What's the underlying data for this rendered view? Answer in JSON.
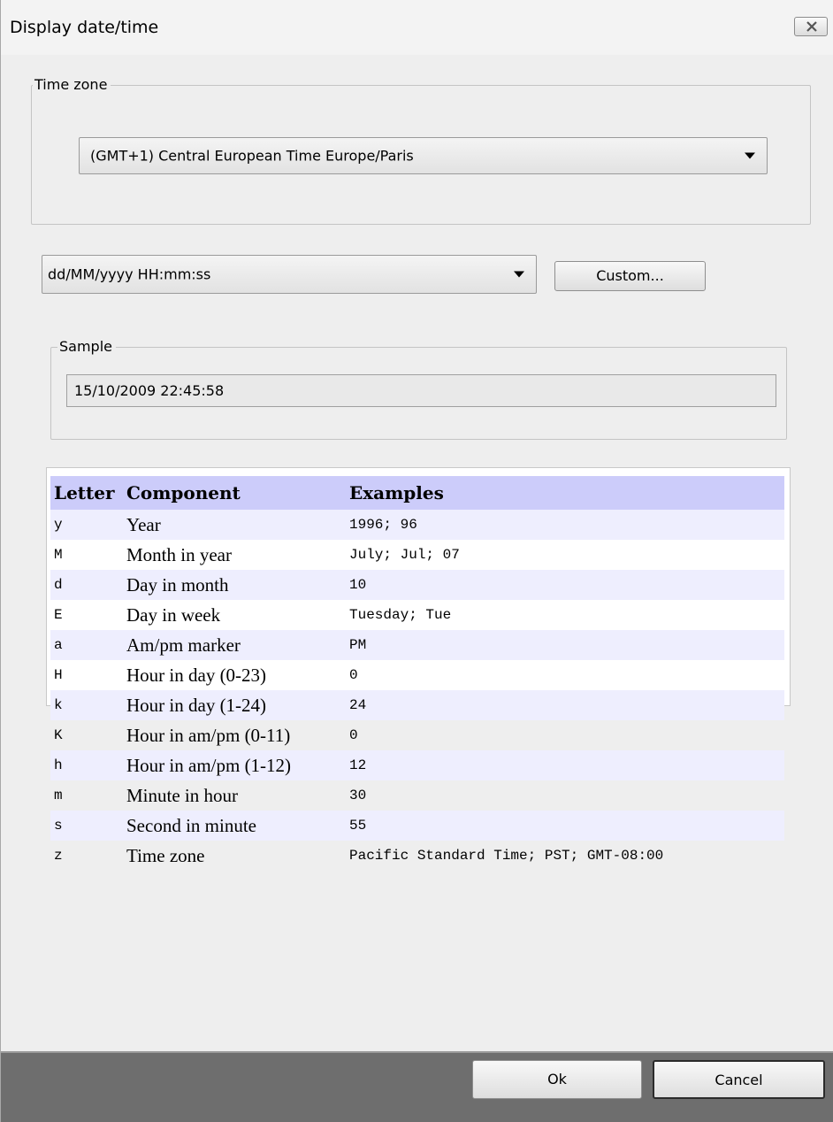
{
  "window": {
    "title": "Display date/time",
    "close_icon": "close-icon"
  },
  "timezone_group": {
    "legend": "Time zone",
    "selected": "(GMT+1) Central European Time Europe/Paris"
  },
  "format": {
    "selected": "dd/MM/yyyy HH:mm:ss",
    "custom_button": "Custom..."
  },
  "sample_group": {
    "legend": "Sample",
    "value": "15/10/2009 22:45:58"
  },
  "help_table": {
    "headers": [
      "Letter",
      "Component",
      "Examples"
    ],
    "rows": [
      {
        "letter": "y",
        "component": "Year",
        "example": "1996; 96"
      },
      {
        "letter": "M",
        "component": "Month in year",
        "example": "July; Jul; 07"
      },
      {
        "letter": "d",
        "component": "Day in month",
        "example": "10"
      },
      {
        "letter": "E",
        "component": "Day in week",
        "example": "Tuesday; Tue"
      },
      {
        "letter": "a",
        "component": "Am/pm marker",
        "example": "PM"
      },
      {
        "letter": "H",
        "component": "Hour in day (0-23)",
        "example": "0"
      },
      {
        "letter": "k",
        "component": "Hour in day (1-24)",
        "example": "24"
      },
      {
        "letter": "K",
        "component": "Hour in am/pm (0-11)",
        "example": "0"
      },
      {
        "letter": "h",
        "component": "Hour in am/pm (1-12)",
        "example": "12"
      },
      {
        "letter": "m",
        "component": "Minute in hour",
        "example": "30"
      },
      {
        "letter": "s",
        "component": "Second in minute",
        "example": "55"
      },
      {
        "letter": "z",
        "component": "Time zone",
        "example": "Pacific Standard Time; PST; GMT-08:00"
      }
    ]
  },
  "buttons": {
    "ok": "Ok",
    "cancel": "Cancel"
  }
}
